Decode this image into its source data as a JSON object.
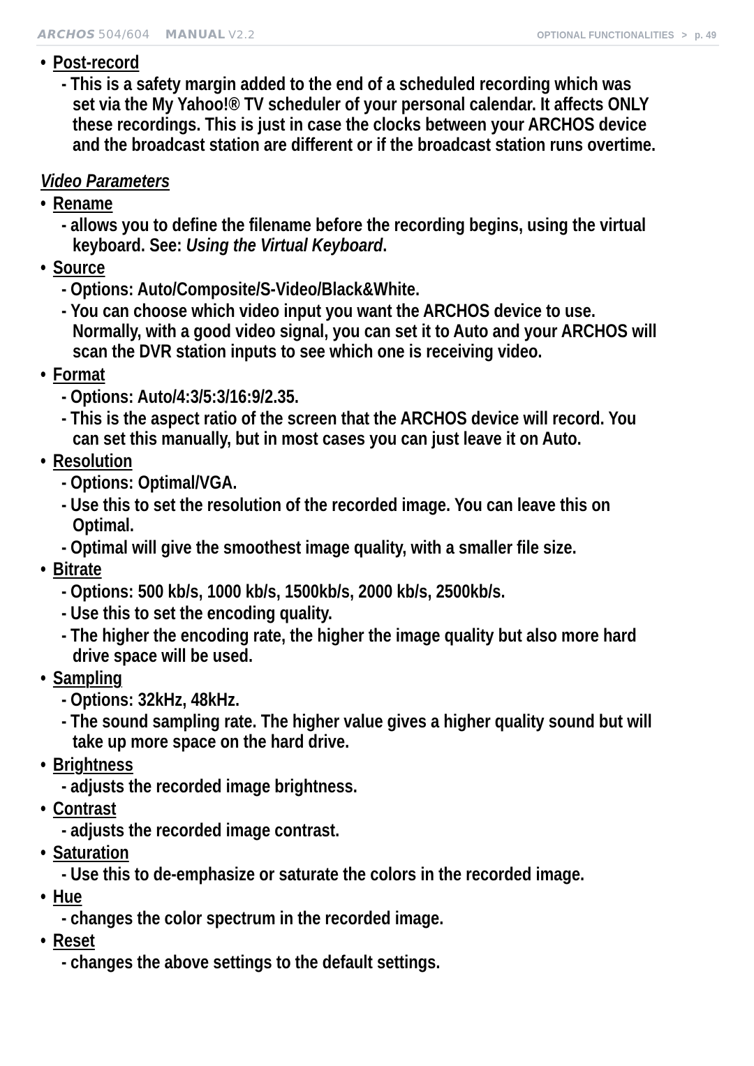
{
  "header": {
    "brand": "ARCHOS",
    "model": "504/604",
    "manual": "MANUAL",
    "version": "V2.2",
    "section": "OPTIONAL FUNCTIONALITIES",
    "separator": ">",
    "page": "p. 49"
  },
  "postrecord": {
    "term": "Post-record",
    "lines": [
      "This is a safety margin added to the end of a scheduled recording which was",
      "set via the My Yahoo!® TV scheduler of your personal calendar. It affects ONLY",
      "these recordings. This is just in case the clocks between your ARCHOS device",
      "and the broadcast station are different or if the broadcast station runs overtime."
    ]
  },
  "section_title": "Video Parameters",
  "items": {
    "rename": {
      "term": "Rename",
      "line1": "allows you to define the filename before the recording begins, using the virtual",
      "line2_prefix": "keyboard. See: ",
      "line2_link": "Using the Virtual Keyboard",
      "line2_suffix": "."
    },
    "source": {
      "term": "Source",
      "options": "Options: Auto/Composite/S-Video/Black&White.",
      "desc": [
        "You can choose which video input you want the ARCHOS device to use.",
        "Normally, with a good video signal, you can set it to Auto and your ARCHOS will",
        "scan the DVR station inputs to see which one is receiving video."
      ]
    },
    "format": {
      "term": "Format",
      "options": "Options: Auto/4:3/5:3/16:9/2.35.",
      "desc": [
        "This is the aspect ratio of the screen that the ARCHOS device will record. You",
        "can set this manually, but in most cases you can just leave it on Auto."
      ]
    },
    "resolution": {
      "term": "Resolution",
      "options": "Options: Optimal/VGA.",
      "desc": [
        "Use this to set the resolution of the recorded image. You can leave this on",
        "Optimal."
      ],
      "desc2": "Optimal will give the smoothest image quality, with a smaller file size."
    },
    "bitrate": {
      "term": "Bitrate",
      "options": "Options: 500 kb/s, 1000 kb/s, 1500kb/s, 2000 kb/s, 2500kb/s.",
      "desc": "Use this to set the encoding quality.",
      "desc2": [
        "The higher the encoding rate, the higher the image quality but also more hard",
        "drive space will be used."
      ]
    },
    "sampling": {
      "term": "Sampling",
      "options": "Options: 32kHz, 48kHz.",
      "desc": [
        "The sound sampling rate. The higher value gives a higher quality sound but will",
        "take up more space on the hard drive."
      ]
    },
    "brightness": {
      "term": "Brightness",
      "desc": "adjusts the recorded image brightness."
    },
    "contrast": {
      "term": "Contrast",
      "desc": "adjusts the recorded image contrast."
    },
    "saturation": {
      "term": "Saturation",
      "desc": "Use this to de-emphasize or saturate the colors in the recorded image."
    },
    "hue": {
      "term": "Hue",
      "desc": "changes the color spectrum in the recorded image."
    },
    "reset": {
      "term": "Reset",
      "desc": "changes the above settings to the default settings."
    }
  },
  "glyphs": {
    "bullet": "•",
    "dash": "-"
  }
}
